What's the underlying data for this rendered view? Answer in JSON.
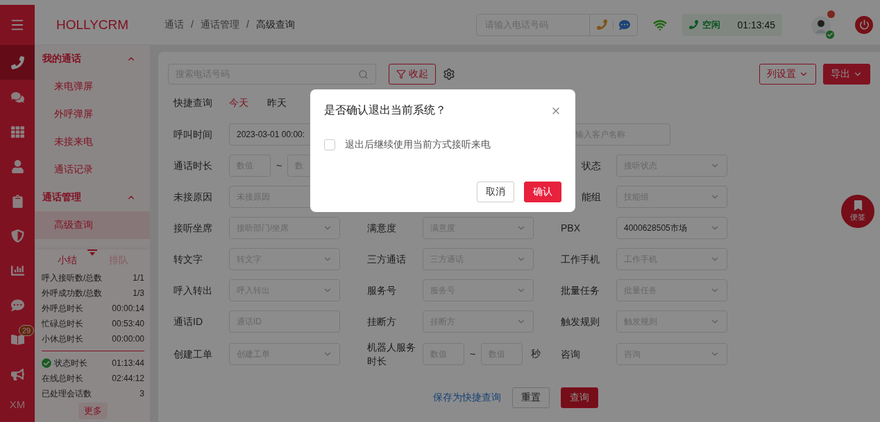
{
  "rail": {
    "items": [
      {
        "selected": true
      },
      {
        "selected": false
      },
      {
        "selected": false
      },
      {
        "selected": false
      },
      {
        "selected": false
      },
      {
        "selected": false
      },
      {
        "selected": false
      },
      {
        "selected": false
      },
      {
        "selected": false,
        "badge": "29"
      },
      {
        "selected": false
      }
    ],
    "footer": "XM"
  },
  "logo": "HOLLYCRM",
  "sidebar": {
    "groups": [
      {
        "title": "我的通话",
        "expanded": true,
        "items": [
          {
            "label": "来电弹屏",
            "selected": false
          },
          {
            "label": "外呼弹屏",
            "selected": false
          },
          {
            "label": "未接来电",
            "selected": false
          },
          {
            "label": "通话记录",
            "selected": false
          }
        ]
      },
      {
        "title": "通话管理",
        "expanded": true,
        "items": [
          {
            "label": "高级查询",
            "selected": true
          }
        ]
      }
    ]
  },
  "summary": {
    "tabs": [
      {
        "label": "小结",
        "selected": true
      },
      {
        "label": "排队",
        "selected": false
      }
    ],
    "stats": [
      {
        "label": "呼入接听数/总数",
        "value": "1/1"
      },
      {
        "label": "外呼成功数/总数",
        "value": "1/3"
      },
      {
        "label": "外呼总时长",
        "value": "00:00:14"
      },
      {
        "label": "忙碌总时长",
        "value": "00:53:40"
      },
      {
        "label": "小休总时长",
        "value": "00:00:00"
      }
    ],
    "status": [
      {
        "kind": "status",
        "label": "状态时长",
        "value": "01:13:44"
      },
      {
        "kind": "plain",
        "label": "在线总时长",
        "value": "02:44:12"
      },
      {
        "kind": "plain",
        "label": "已处理会话数",
        "value": "3"
      }
    ],
    "more": "更多"
  },
  "header": {
    "breadcrumb": [
      "通话",
      "通话管理",
      "高级查询"
    ],
    "separator": "/",
    "phone_search": {
      "placeholder": "请输入电话号码"
    },
    "status": {
      "label": "空闲",
      "time": "01:13:45"
    },
    "avatar": {
      "online": true,
      "unread": true
    }
  },
  "toolbar": {
    "search": {
      "placeholder": "搜索电话号码"
    },
    "collapse": "收起",
    "column_settings": "列设置",
    "export": "导出"
  },
  "quick_query": {
    "label": "快捷查询",
    "options": [
      {
        "label": "今天",
        "selected": true
      },
      {
        "label": "昨天",
        "selected": false
      }
    ]
  },
  "filter_rows": [
    {
      "column_1": {
        "label": "呼叫时间",
        "kind": "date",
        "value": "2023-03-01 00:00:"
      },
      "column_3": {
        "kind": "input",
        "placeholder": "输入客户名称"
      }
    },
    {
      "column_1": {
        "label": "通话时长",
        "kind": "range",
        "from": "数值",
        "to": "数",
        "separator": "~"
      },
      "column_3": {
        "label": "状态",
        "kind": "select",
        "placeholder": "接听状态"
      }
    },
    {
      "column_1": {
        "label": "未接原因",
        "kind": "select",
        "placeholder": "未接原因"
      },
      "column_3": {
        "label": "能组",
        "kind": "select",
        "placeholder": "技能组"
      }
    },
    {
      "column_1": {
        "label": "接听坐席",
        "kind": "select",
        "placeholder": "接听部门/坐席"
      },
      "column_2": {
        "label": "满意度",
        "kind": "select",
        "placeholder": "满意度"
      },
      "column_3": {
        "label": "PBX",
        "kind": "select",
        "value": "4000628505市场"
      }
    },
    {
      "column_1": {
        "label": "转文字",
        "kind": "select",
        "placeholder": "转文字"
      },
      "column_2": {
        "label": "三方通话",
        "kind": "select",
        "placeholder": "三方通话"
      },
      "column_3": {
        "label": "工作手机",
        "kind": "select",
        "placeholder": "工作手机"
      }
    },
    {
      "column_1": {
        "label": "呼入转出",
        "kind": "select",
        "placeholder": "呼入转出"
      },
      "column_2": {
        "label": "服务号",
        "kind": "select",
        "placeholder": "服务号"
      },
      "column_3": {
        "label": "批量任务",
        "kind": "select",
        "placeholder": "批量任务"
      }
    },
    {
      "column_1": {
        "label": "通话ID",
        "kind": "input",
        "placeholder": "通话ID"
      },
      "column_2": {
        "label": "挂断方",
        "kind": "select",
        "placeholder": "挂断方"
      },
      "column_3": {
        "label": "触发规则",
        "kind": "select",
        "placeholder": "触发规则"
      }
    },
    {
      "column_1": {
        "label": "创建工单",
        "kind": "select",
        "placeholder": "创建工单"
      },
      "column_2": {
        "label": "机器人服务时长",
        "kind": "range",
        "from": "数值",
        "to": "数值",
        "separator": "~",
        "unit": "秒"
      },
      "column_3": {
        "label": "咨询",
        "kind": "select",
        "placeholder": "咨询"
      }
    }
  ],
  "actions": {
    "save": "保存为快捷查询",
    "reset": "重置",
    "query": "查询"
  },
  "float_button": "便签",
  "dialog": {
    "title": "是否确认退出当前系统？",
    "checkbox": {
      "label": "退出后继续使用当前方式接听来电",
      "checked": false
    },
    "cancel": "取消",
    "confirm": "确认"
  }
}
